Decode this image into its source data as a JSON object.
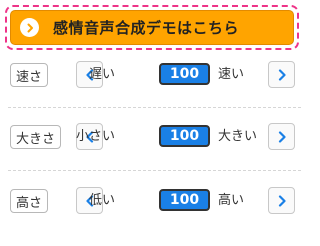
{
  "demo": {
    "label": "感情音声合成デモはこちら",
    "icon": "chevron-right-icon",
    "background_color": "#ffa400",
    "border_color": "#ee3388"
  },
  "controls": [
    {
      "label": "速さ",
      "min_label": "遅い",
      "value": "100",
      "max_label": "速い"
    },
    {
      "label": "大きさ",
      "min_label": "小さい",
      "value": "100",
      "max_label": "大きい"
    },
    {
      "label": "高さ",
      "min_label": "低い",
      "value": "100",
      "max_label": "高い"
    }
  ],
  "icons": {
    "decrease": "chevron-left-icon",
    "increase": "chevron-right-icon"
  },
  "colors": {
    "value_background": "#1a80e6",
    "chevron": "#1a80e6"
  }
}
